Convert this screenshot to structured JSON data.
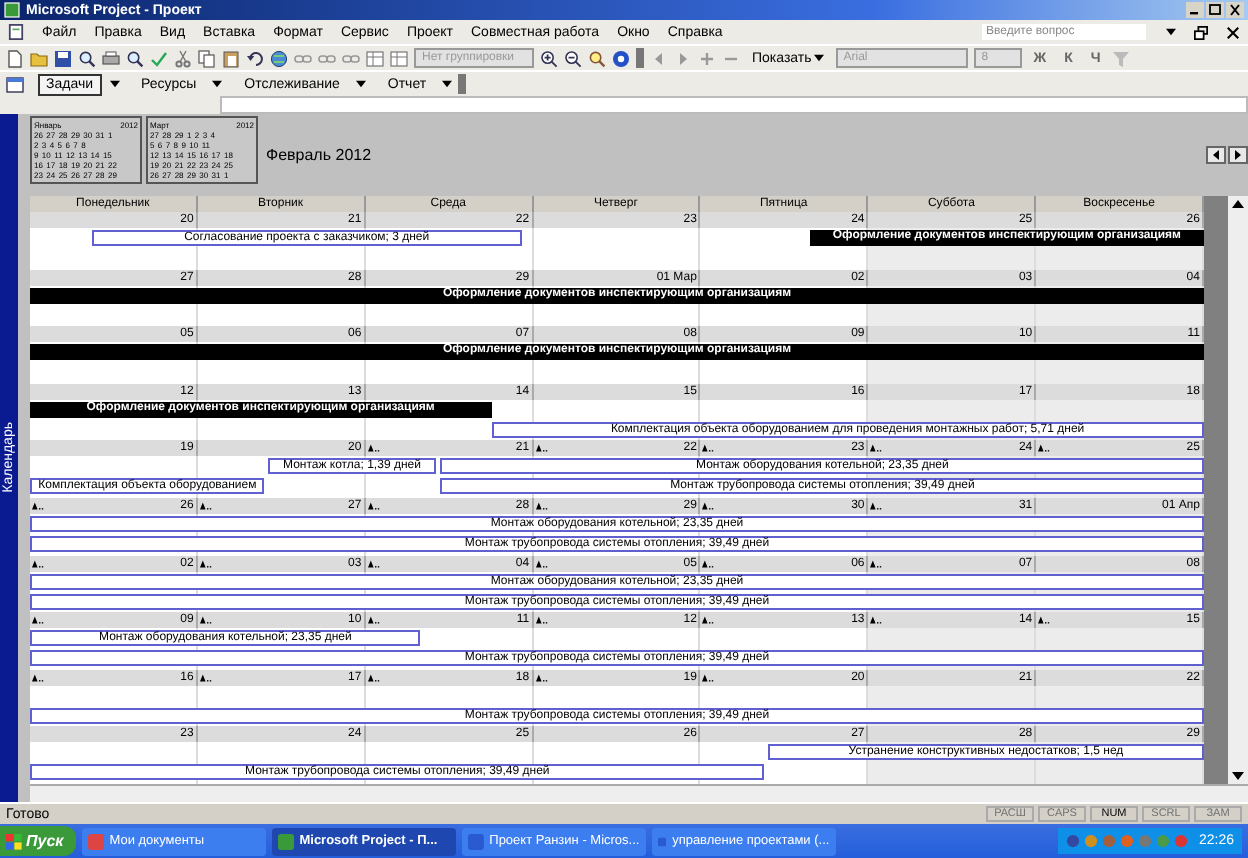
{
  "window": {
    "title": "Microsoft Project - Проект"
  },
  "menu": [
    "Файл",
    "Правка",
    "Вид",
    "Вставка",
    "Формат",
    "Сервис",
    "Проект",
    "Совместная работа",
    "Окно",
    "Справка"
  ],
  "help_search": {
    "placeholder": "Введите вопрос"
  },
  "toolbar": {
    "grouping": {
      "value": "Нет группировки",
      "disabled": true
    },
    "show_button": "Показать",
    "font": {
      "value": "Arial",
      "disabled": true
    },
    "font_size": {
      "value": "8",
      "disabled": true
    },
    "format_buttons": [
      "Ж",
      "К",
      "Ч"
    ]
  },
  "guide_toolbar": [
    {
      "label": "Задачи",
      "selected": true
    },
    {
      "label": "Ресурсы",
      "selected": false
    },
    {
      "label": "Отслеживание",
      "selected": false
    },
    {
      "label": "Отчет",
      "selected": false
    }
  ],
  "view_bar": {
    "label": "Календарь"
  },
  "mini_calendars": [
    {
      "month": "Январь",
      "year": "2012",
      "weeks": [
        "26 27 28 29 30 31 1",
        "2 3 4 5 6 7 8",
        "9 10 11 12 13 14 15",
        "16 17 18 19 20 21 22",
        "23 24 25 26 27 28 29"
      ]
    },
    {
      "month": "Март",
      "year": "2012",
      "weeks": [
        "27 28 29 1 2 3 4",
        "5 6 7 8 9 10 11",
        "12 13 14 15 16 17 18",
        "19 20 21 22 23 24 25",
        "26 27 28 29 30 31 1"
      ]
    }
  ],
  "month_title": "Февраль 2012",
  "day_names": [
    "Понедельник",
    "Вторник",
    "Среда",
    "Четверг",
    "Пятница",
    "Суббота",
    "Воскресенье"
  ],
  "weeks": [
    {
      "days": [
        {
          "date": "20",
          "more": false
        },
        {
          "date": "21",
          "more": false
        },
        {
          "date": "22",
          "more": false
        },
        {
          "date": "23",
          "more": false
        },
        {
          "date": "24",
          "more": false
        },
        {
          "date": "25",
          "more": false
        },
        {
          "date": "26",
          "more": false
        }
      ],
      "bars": [
        {
          "label": "Согласование проекта с заказчиком; 3 дней",
          "kind": "task"
        },
        {
          "label": "Оформление документов инспектирующим организациям",
          "kind": "summary"
        }
      ]
    },
    {
      "days": [
        {
          "date": "27",
          "more": false
        },
        {
          "date": "28",
          "more": false
        },
        {
          "date": "29",
          "more": false
        },
        {
          "date": "01 Мар",
          "more": false
        },
        {
          "date": "02",
          "more": false
        },
        {
          "date": "03",
          "more": false
        },
        {
          "date": "04",
          "more": false
        }
      ],
      "bars": [
        {
          "label": "Оформление документов инспектирующим организациям",
          "kind": "summary"
        }
      ]
    },
    {
      "days": [
        {
          "date": "05",
          "more": false
        },
        {
          "date": "06",
          "more": false
        },
        {
          "date": "07",
          "more": false
        },
        {
          "date": "08",
          "more": false
        },
        {
          "date": "09",
          "more": false
        },
        {
          "date": "10",
          "more": false
        },
        {
          "date": "11",
          "more": false
        }
      ],
      "bars": [
        {
          "label": "Оформление документов инспектирующим организациям",
          "kind": "summary"
        }
      ]
    },
    {
      "days": [
        {
          "date": "12",
          "more": false
        },
        {
          "date": "13",
          "more": false
        },
        {
          "date": "14",
          "more": false
        },
        {
          "date": "15",
          "more": false
        },
        {
          "date": "16",
          "more": false
        },
        {
          "date": "17",
          "more": false
        },
        {
          "date": "18",
          "more": false
        }
      ],
      "bars": [
        {
          "label": "Оформление документов инспектирующим организациям",
          "kind": "summary"
        },
        {
          "label": "Комплектация объекта оборудованием для проведения монтажных работ; 5,71 дней",
          "kind": "task"
        }
      ]
    },
    {
      "days": [
        {
          "date": "19",
          "more": false
        },
        {
          "date": "20",
          "more": false
        },
        {
          "date": "21",
          "more": true
        },
        {
          "date": "22",
          "more": true
        },
        {
          "date": "23",
          "more": true
        },
        {
          "date": "24",
          "more": true
        },
        {
          "date": "25",
          "more": true
        }
      ],
      "bars": [
        {
          "label": "Монтаж котла; 1,39 дней",
          "kind": "task"
        },
        {
          "label": "Монтаж оборудования котельной; 23,35 дней",
          "kind": "task"
        },
        {
          "label": "Комплектация объекта оборудованием",
          "kind": "task"
        },
        {
          "label": "Монтаж трубопровода системы отопления; 39,49 дней",
          "kind": "task"
        }
      ]
    },
    {
      "days": [
        {
          "date": "26",
          "more": true
        },
        {
          "date": "27",
          "more": true
        },
        {
          "date": "28",
          "more": true
        },
        {
          "date": "29",
          "more": true
        },
        {
          "date": "30",
          "more": true
        },
        {
          "date": "31",
          "more": true
        },
        {
          "date": "01 Апр",
          "more": false
        }
      ],
      "bars": [
        {
          "label": "Монтаж оборудования котельной; 23,35 дней",
          "kind": "task"
        },
        {
          "label": "Монтаж трубопровода системы отопления; 39,49 дней",
          "kind": "task"
        }
      ]
    },
    {
      "days": [
        {
          "date": "02",
          "more": true
        },
        {
          "date": "03",
          "more": true
        },
        {
          "date": "04",
          "more": true
        },
        {
          "date": "05",
          "more": true
        },
        {
          "date": "06",
          "more": true
        },
        {
          "date": "07",
          "more": true
        },
        {
          "date": "08",
          "more": false
        }
      ],
      "bars": [
        {
          "label": "Монтаж оборудования котельной; 23,35 дней",
          "kind": "task"
        },
        {
          "label": "Монтаж трубопровода системы отопления; 39,49 дней",
          "kind": "task"
        }
      ]
    },
    {
      "days": [
        {
          "date": "09",
          "more": true
        },
        {
          "date": "10",
          "more": true
        },
        {
          "date": "11",
          "more": true
        },
        {
          "date": "12",
          "more": true
        },
        {
          "date": "13",
          "more": true
        },
        {
          "date": "14",
          "more": true
        },
        {
          "date": "15",
          "more": true
        }
      ],
      "bars": [
        {
          "label": "Монтаж оборудования котельной; 23,35 дней",
          "kind": "task"
        },
        {
          "label": "Монтаж трубопровода системы отопления; 39,49 дней",
          "kind": "task"
        }
      ]
    },
    {
      "days": [
        {
          "date": "16",
          "more": true
        },
        {
          "date": "17",
          "more": true
        },
        {
          "date": "18",
          "more": true
        },
        {
          "date": "19",
          "more": true
        },
        {
          "date": "20",
          "more": true
        },
        {
          "date": "21",
          "more": false
        },
        {
          "date": "22",
          "more": false
        }
      ],
      "bars": [
        {
          "label": "Монтаж трубопровода системы отопления; 39,49 дней",
          "kind": "task"
        }
      ]
    },
    {
      "days": [
        {
          "date": "23",
          "more": false
        },
        {
          "date": "24",
          "more": false
        },
        {
          "date": "25",
          "more": false
        },
        {
          "date": "26",
          "more": false
        },
        {
          "date": "27",
          "more": false
        },
        {
          "date": "28",
          "more": false
        },
        {
          "date": "29",
          "more": false
        }
      ],
      "bars": [
        {
          "label": "Устранение конструктивных недостатков; 1,5 нед",
          "kind": "task"
        },
        {
          "label": "Монтаж трубопровода системы отопления; 39,49 дней",
          "kind": "task"
        }
      ]
    }
  ],
  "status_bar": {
    "text": "Готово",
    "indicators": [
      {
        "label": "РАСШ",
        "on": false
      },
      {
        "label": "CAPS",
        "on": false
      },
      {
        "label": "NUM",
        "on": true
      },
      {
        "label": "SCRL",
        "on": false
      },
      {
        "label": "ЗАМ",
        "on": false
      }
    ]
  },
  "taskbar": {
    "start": "Пуск",
    "buttons": [
      {
        "label": "Мои документы",
        "selected": false
      },
      {
        "label": "Microsoft Project - П...",
        "selected": true
      },
      {
        "label": "Проект Ранзин - Micros...",
        "selected": false
      },
      {
        "label": "управление проектами (...",
        "selected": false
      }
    ],
    "clock": "22:26"
  }
}
